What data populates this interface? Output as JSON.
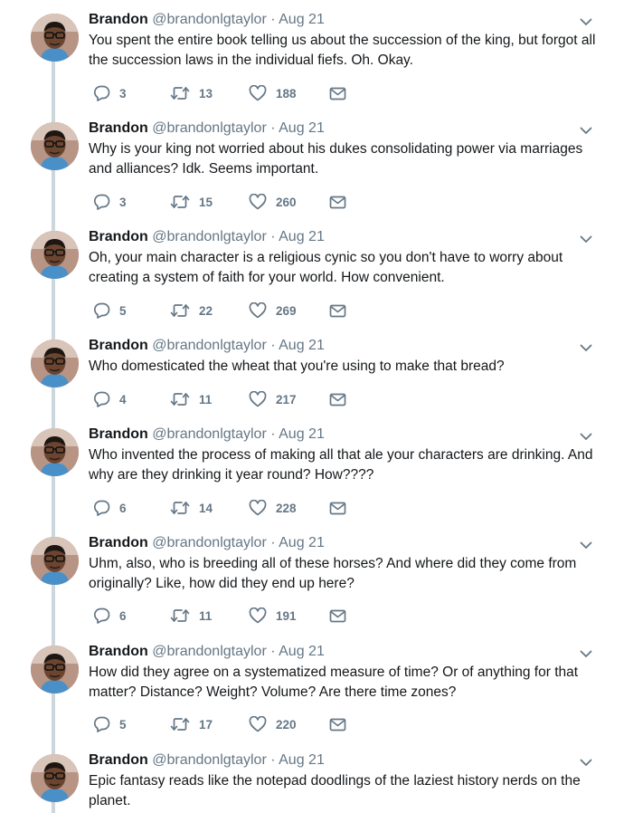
{
  "colors": {
    "name": "#14171a",
    "secondary": "#657786",
    "thread_line": "#ccd6dd",
    "icon": "#657786"
  },
  "tweets": [
    {
      "name": "Brandon",
      "handle": "@brandonlgtaylor",
      "separator": "·",
      "date": "Aug 21",
      "text": "You spent the entire book telling us about the succession of the king, but forgot all the succession laws in the individual fiefs. Oh. Okay.",
      "replies": "3",
      "retweets": "13",
      "likes": "188"
    },
    {
      "name": "Brandon",
      "handle": "@brandonlgtaylor",
      "separator": "·",
      "date": "Aug 21",
      "text": "Why is your king not worried about his dukes consolidating power via marriages and alliances? Idk. Seems important.",
      "replies": "3",
      "retweets": "15",
      "likes": "260"
    },
    {
      "name": "Brandon",
      "handle": "@brandonlgtaylor",
      "separator": "·",
      "date": "Aug 21",
      "text": "Oh, your main character is a religious cynic so you don't have to worry about creating a system of faith for your world. How convenient.",
      "replies": "5",
      "retweets": "22",
      "likes": "269"
    },
    {
      "name": "Brandon",
      "handle": "@brandonlgtaylor",
      "separator": "·",
      "date": "Aug 21",
      "text": "Who domesticated the wheat that you're using to make that bread?",
      "replies": "4",
      "retweets": "11",
      "likes": "217"
    },
    {
      "name": "Brandon",
      "handle": "@brandonlgtaylor",
      "separator": "·",
      "date": "Aug 21",
      "text": "Who invented the process of making all that ale your characters are drinking. And why are they drinking it year round? How????",
      "replies": "6",
      "retweets": "14",
      "likes": "228"
    },
    {
      "name": "Brandon",
      "handle": "@brandonlgtaylor",
      "separator": "·",
      "date": "Aug 21",
      "text": "Uhm, also, who is breeding all of these horses? And where did they come from originally? Like, how did they end up here?",
      "replies": "6",
      "retweets": "11",
      "likes": "191"
    },
    {
      "name": "Brandon",
      "handle": "@brandonlgtaylor",
      "separator": "·",
      "date": "Aug 21",
      "text": "How did they agree on a systematized measure of time? Or of anything for that matter? Distance? Weight? Volume? Are there time zones?",
      "replies": "5",
      "retweets": "17",
      "likes": "220"
    },
    {
      "name": "Brandon",
      "handle": "@brandonlgtaylor",
      "separator": "·",
      "date": "Aug 21",
      "text": "Epic fantasy reads like the notepad doodlings of the laziest history nerds on the planet."
    }
  ]
}
